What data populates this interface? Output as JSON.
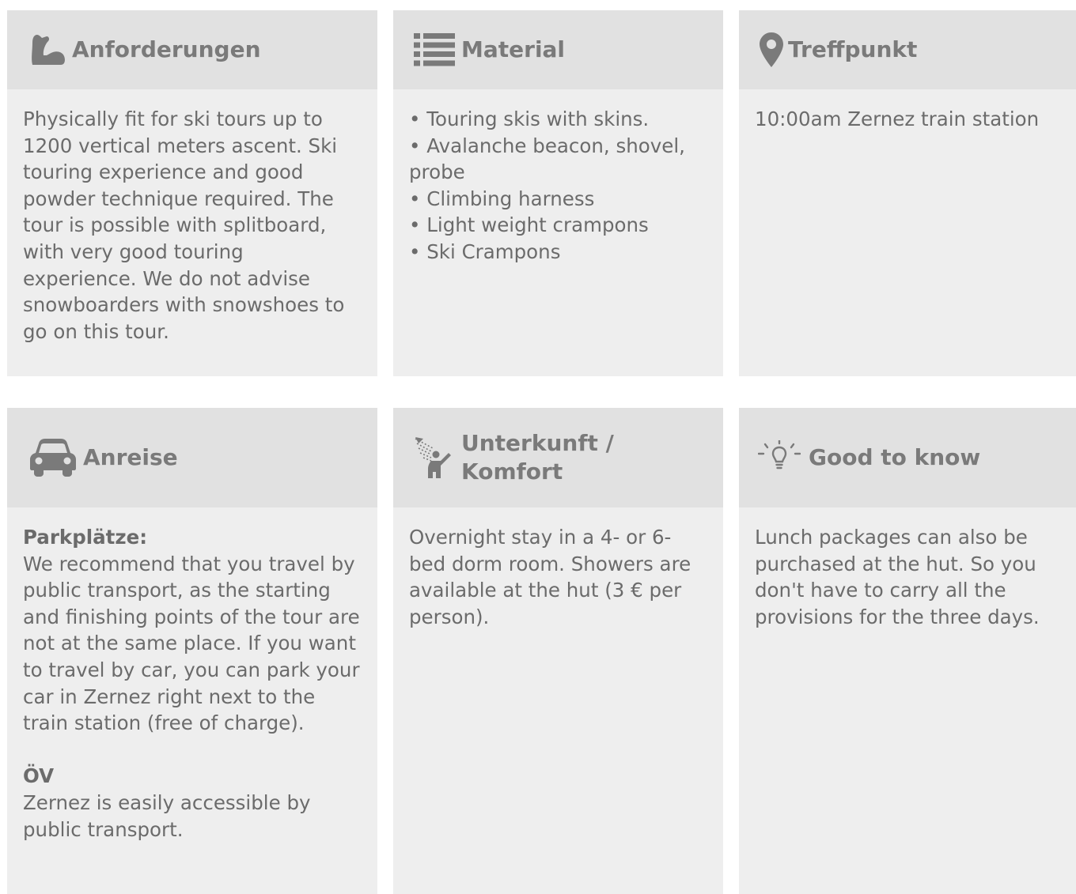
{
  "cards": {
    "anforderungen": {
      "title": "Anforderungen",
      "icon": "flexed-arm-icon",
      "text": "Physically fit for ski tours up to 1200 vertical meters ascent. Ski touring experience and good powder technique required. The tour is possible with splitboard, with very good touring experience. We do not advise snowboarders with snowshoes to go on this tour."
    },
    "material": {
      "title": "Material",
      "icon": "list-icon",
      "items": [
        "• Touring skis with skins.",
        "• Avalanche beacon, shovel, probe",
        "• Climbing harness",
        "• Light weight crampons",
        "• Ski Crampons"
      ]
    },
    "treffpunkt": {
      "title": "Treffpunkt",
      "icon": "map-pin-icon",
      "text": "10:00am Zernez train station"
    },
    "anreise": {
      "title": "Anreise",
      "icon": "car-icon",
      "parking_label": "Parkplätze:",
      "parking_text": "We recommend that you travel by public transport, as the starting and finishing points of the tour are not at the same place. If you want to travel by car, you can park your car in Zernez right next to the train station (free of charge).",
      "ov_label": "ÖV",
      "ov_text": "Zernez is easily accessible by public transport."
    },
    "unterkunft": {
      "title": "Unterkunft / Komfort",
      "icon": "shower-icon",
      "text": "Overnight stay in a 4- or 6-bed dorm room. Showers are available at the hut (3 € per person)."
    },
    "good_to_know": {
      "title": "Good to know",
      "icon": "lightbulb-icon",
      "text": "Lunch packages can also be purchased at the hut. So you don't have to carry all the provisions for the three days."
    }
  }
}
